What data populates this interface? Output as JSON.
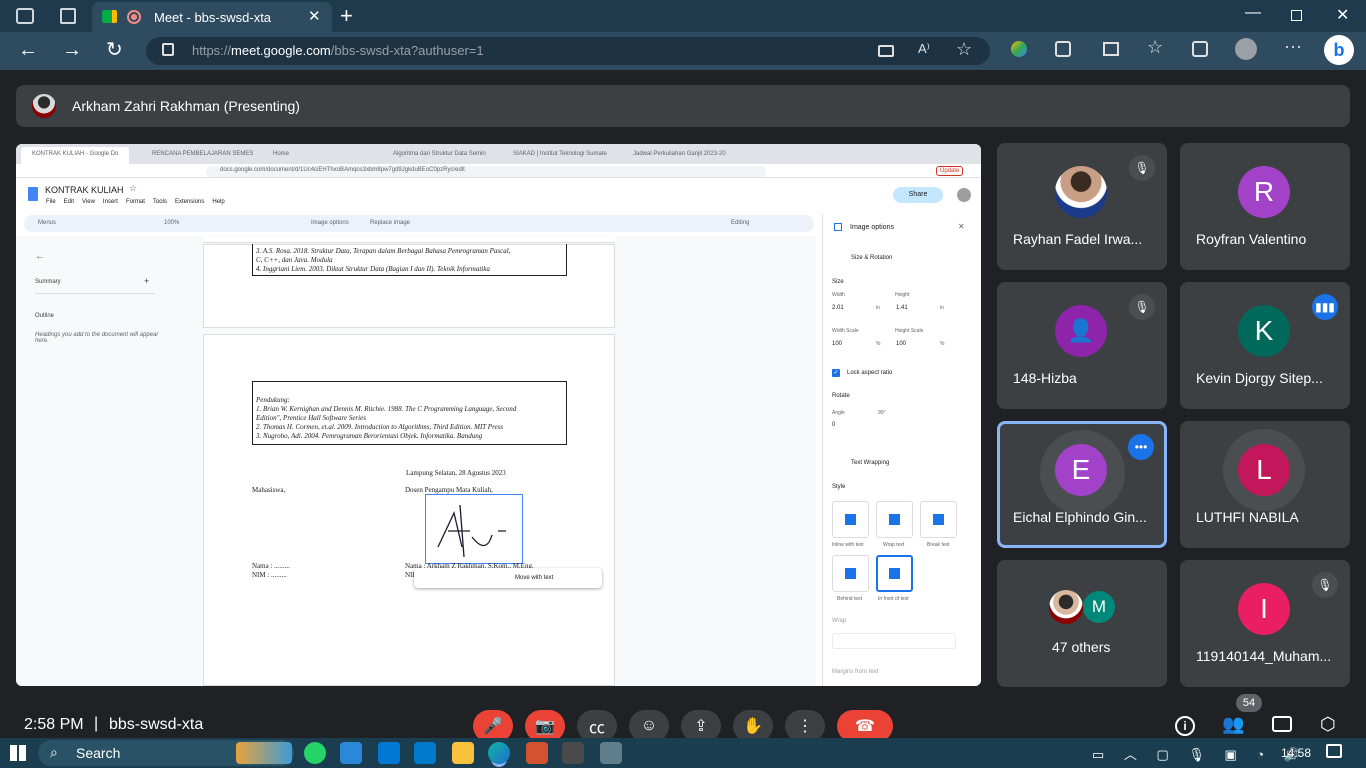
{
  "browser": {
    "tab_title": "Meet - bbs-swsd-xta",
    "url_prefix": "https://",
    "url_host": "meet.google.com",
    "url_path": "/bbs-swsd-xta?authuser=1"
  },
  "presenter": {
    "label": "Arkham Zahri Rakhman (Presenting)"
  },
  "shared": {
    "tabs": [
      "KONTRAK KULIAH - Google Do",
      "RENCANA PEMBELAJARAN SEMES",
      "Home",
      "Algoritma dan Struktur Data Semin",
      "SIAKAD | Institut Teknologi Sumate",
      "Jadwal Perkuliahan Ganjil 2023-20"
    ],
    "url": "docs.google.com/document/d/1Uc4ciEHThxoBAmqos3xbm8pw7gd9JgkduBEoC0pzRyc/edit",
    "update": "Update",
    "doc_title": "KONTRAK KULIAH",
    "menus": [
      "File",
      "Edit",
      "View",
      "Insert",
      "Format",
      "Tools",
      "Extensions",
      "Help"
    ],
    "share": "Share",
    "toolbar": {
      "menus": "Menus",
      "zoom": "100%",
      "image_options": "Image options",
      "replace_image": "Replace image",
      "editing": "Editing"
    },
    "sidebar": {
      "summary": "Summary",
      "outline": "Outline",
      "hint": "Headings you add to the document will appear here."
    },
    "refs_top": [
      "3.   A.S. Rosa. 2018. Struktur Data, Terapan dalam Berbagai Bahasa Pemrograman Pascal,",
      "       C, C++, dan Java. Modula",
      "4.   Inggriani Liem. 2003. Diktat Struktur Data (Bagian I dan II). Teknik Informatika"
    ],
    "refs_support": [
      "Pendukung:",
      "1.   Brian W. Kernighan and Dennis M. Ritchie. 1988. The C Programming Language, Second",
      "       Edition\", Prentice Hall Software Series",
      "2.   Thomas H. Cormen, et.al. 2009. Introduction to Algorithms, Third Edition. MIT Press",
      "3.   Nugroho, Adi. 2004. Pemrograman Berorientasi Objek. Informatika. Bandung"
    ],
    "place_date": "Lampung Selatan, 28 Agustus 2023",
    "student": "Mahasiswa,",
    "lecturer": "Dosen Pengampu Mata Kuliah,",
    "nama_left": "Nama    : .........",
    "nim_left": "NIM      : .........",
    "nama_right": "Nama      : Arkham Z Rakhman, S.Kom., M.Eng.",
    "nim_right": "NIP",
    "move_with_text": "Move with text",
    "panel": {
      "title": "Image options",
      "size_rotation": "Size & Rotation",
      "size": "Size",
      "width_label": "Width",
      "width": "2.01",
      "height_label": "Height",
      "height": "1.41",
      "unit": "in",
      "width_scale_label": "Width Scale",
      "width_scale": "100",
      "height_scale_label": "Height Scale",
      "height_scale": "100",
      "pct": "%",
      "lock": "Lock aspect ratio",
      "rotate": "Rotate",
      "angle_label": "Angle",
      "angle": "0",
      "deg90": "90°",
      "text_wrapping": "Text Wrapping",
      "style": "Style",
      "wrap_opts": [
        "Inline with text",
        "Wrap text",
        "Break text",
        "Behind text",
        "In front of text"
      ],
      "wrap": "Wrap",
      "margins": "Margins from text"
    }
  },
  "participants": [
    {
      "name": "Rayhan Fadel Irwa...",
      "initial": "",
      "color": "#1a3a8a",
      "muted": true
    },
    {
      "name": "Royfran Valentino",
      "initial": "R",
      "color": "#a142c8",
      "muted": false
    },
    {
      "name": "148-Hizba",
      "initial": "",
      "color": "#8e24aa",
      "muted": true
    },
    {
      "name": "Kevin Djorgy Sitep...",
      "initial": "K",
      "color": "#00695c",
      "muted": false
    },
    {
      "name": "Eichal Elphindo Gin...",
      "initial": "E",
      "color": "#a142c8",
      "muted": false
    },
    {
      "name": "LUTHFI NABILA",
      "initial": "L",
      "color": "#c2185b",
      "muted": false
    },
    {
      "name": "47 others",
      "initial": "M",
      "color": "#00897b",
      "muted": false
    },
    {
      "name": "119140144_Muham...",
      "initial": "I",
      "color": "#e91e63",
      "muted": true
    }
  ],
  "meeting": {
    "time": "2:58 PM",
    "separator": "|",
    "code": "bbs-swsd-xta",
    "people_count": "54"
  },
  "taskbar": {
    "search": "Search",
    "clock": "14:58"
  }
}
